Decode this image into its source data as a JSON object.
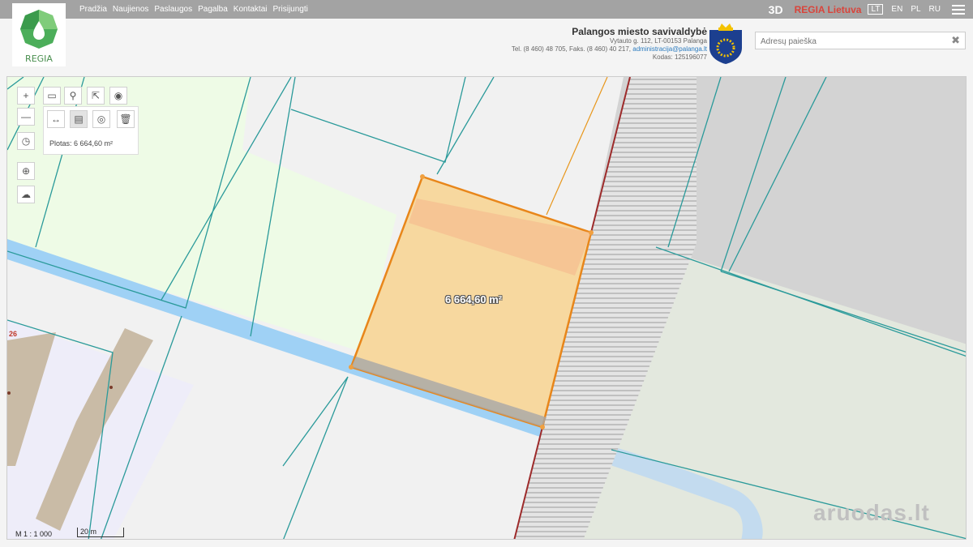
{
  "nav": {
    "items": [
      "Pradžia",
      "Naujienos",
      "Paslaugos",
      "Pagalba",
      "Kontaktai",
      "Prisijungti"
    ],
    "btn_3d": "3D",
    "regia_lietuva": "REGIA Lietuva",
    "languages": [
      "LT",
      "EN",
      "PL",
      "RU"
    ],
    "active_language": "LT",
    "menu_icon": "hamburger-icon"
  },
  "logo": {
    "text": "REGIA",
    "icon": "regia-logo-icon"
  },
  "institution": {
    "name": "Palangos miesto savivaldybė",
    "address": "Vytauto g. 112, LT-00153 Palanga",
    "phone": "Tel. (8 460) 48 705, Faks. (8 460) 40 217,",
    "email": "administracija@palanga.lt",
    "code": "Kodas: 125196077",
    "crest_icon": "palanga-crest-icon"
  },
  "search": {
    "placeholder": "Adresų paieška",
    "value": ""
  },
  "map": {
    "measure_result": "Plotas: 6 664,60 m²",
    "area_label": "6 664,60 m²",
    "scale": "M 1 : 1 000",
    "scalebar": "20 m",
    "parcel_number": "26",
    "watermark": "aruodas.lt",
    "colors": {
      "parcel_fill": "#f7d596",
      "parcel_stroke": "#e8861a",
      "water": "#9fd1f5",
      "green_zone": "#eefbe6",
      "building": "#c9bba6",
      "cadastre_line": "#2a9a9a",
      "railway": "#9d2b2b"
    }
  },
  "tools": {
    "zoom_in": "+",
    "zoom_out": "—"
  }
}
